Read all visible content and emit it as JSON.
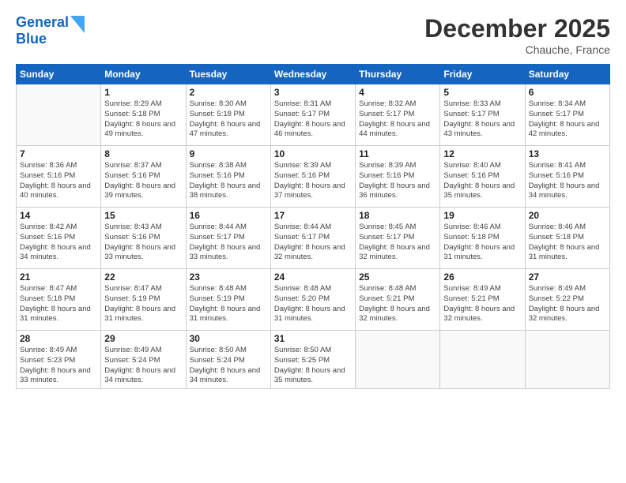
{
  "logo": {
    "line1": "General",
    "line2": "Blue"
  },
  "title": "December 2025",
  "location": "Chauche, France",
  "weekdays": [
    "Sunday",
    "Monday",
    "Tuesday",
    "Wednesday",
    "Thursday",
    "Friday",
    "Saturday"
  ],
  "weeks": [
    [
      {
        "day": "",
        "sunrise": "",
        "sunset": "",
        "daylight": ""
      },
      {
        "day": "1",
        "sunrise": "Sunrise: 8:29 AM",
        "sunset": "Sunset: 5:18 PM",
        "daylight": "Daylight: 8 hours and 49 minutes."
      },
      {
        "day": "2",
        "sunrise": "Sunrise: 8:30 AM",
        "sunset": "Sunset: 5:18 PM",
        "daylight": "Daylight: 8 hours and 47 minutes."
      },
      {
        "day": "3",
        "sunrise": "Sunrise: 8:31 AM",
        "sunset": "Sunset: 5:17 PM",
        "daylight": "Daylight: 8 hours and 46 minutes."
      },
      {
        "day": "4",
        "sunrise": "Sunrise: 8:32 AM",
        "sunset": "Sunset: 5:17 PM",
        "daylight": "Daylight: 8 hours and 44 minutes."
      },
      {
        "day": "5",
        "sunrise": "Sunrise: 8:33 AM",
        "sunset": "Sunset: 5:17 PM",
        "daylight": "Daylight: 8 hours and 43 minutes."
      },
      {
        "day": "6",
        "sunrise": "Sunrise: 8:34 AM",
        "sunset": "Sunset: 5:17 PM",
        "daylight": "Daylight: 8 hours and 42 minutes."
      }
    ],
    [
      {
        "day": "7",
        "sunrise": "Sunrise: 8:36 AM",
        "sunset": "Sunset: 5:16 PM",
        "daylight": "Daylight: 8 hours and 40 minutes."
      },
      {
        "day": "8",
        "sunrise": "Sunrise: 8:37 AM",
        "sunset": "Sunset: 5:16 PM",
        "daylight": "Daylight: 8 hours and 39 minutes."
      },
      {
        "day": "9",
        "sunrise": "Sunrise: 8:38 AM",
        "sunset": "Sunset: 5:16 PM",
        "daylight": "Daylight: 8 hours and 38 minutes."
      },
      {
        "day": "10",
        "sunrise": "Sunrise: 8:39 AM",
        "sunset": "Sunset: 5:16 PM",
        "daylight": "Daylight: 8 hours and 37 minutes."
      },
      {
        "day": "11",
        "sunrise": "Sunrise: 8:39 AM",
        "sunset": "Sunset: 5:16 PM",
        "daylight": "Daylight: 8 hours and 36 minutes."
      },
      {
        "day": "12",
        "sunrise": "Sunrise: 8:40 AM",
        "sunset": "Sunset: 5:16 PM",
        "daylight": "Daylight: 8 hours and 35 minutes."
      },
      {
        "day": "13",
        "sunrise": "Sunrise: 8:41 AM",
        "sunset": "Sunset: 5:16 PM",
        "daylight": "Daylight: 8 hours and 34 minutes."
      }
    ],
    [
      {
        "day": "14",
        "sunrise": "Sunrise: 8:42 AM",
        "sunset": "Sunset: 5:16 PM",
        "daylight": "Daylight: 8 hours and 34 minutes."
      },
      {
        "day": "15",
        "sunrise": "Sunrise: 8:43 AM",
        "sunset": "Sunset: 5:16 PM",
        "daylight": "Daylight: 8 hours and 33 minutes."
      },
      {
        "day": "16",
        "sunrise": "Sunrise: 8:44 AM",
        "sunset": "Sunset: 5:17 PM",
        "daylight": "Daylight: 8 hours and 33 minutes."
      },
      {
        "day": "17",
        "sunrise": "Sunrise: 8:44 AM",
        "sunset": "Sunset: 5:17 PM",
        "daylight": "Daylight: 8 hours and 32 minutes."
      },
      {
        "day": "18",
        "sunrise": "Sunrise: 8:45 AM",
        "sunset": "Sunset: 5:17 PM",
        "daylight": "Daylight: 8 hours and 32 minutes."
      },
      {
        "day": "19",
        "sunrise": "Sunrise: 8:46 AM",
        "sunset": "Sunset: 5:18 PM",
        "daylight": "Daylight: 8 hours and 31 minutes."
      },
      {
        "day": "20",
        "sunrise": "Sunrise: 8:46 AM",
        "sunset": "Sunset: 5:18 PM",
        "daylight": "Daylight: 8 hours and 31 minutes."
      }
    ],
    [
      {
        "day": "21",
        "sunrise": "Sunrise: 8:47 AM",
        "sunset": "Sunset: 5:18 PM",
        "daylight": "Daylight: 8 hours and 31 minutes."
      },
      {
        "day": "22",
        "sunrise": "Sunrise: 8:47 AM",
        "sunset": "Sunset: 5:19 PM",
        "daylight": "Daylight: 8 hours and 31 minutes."
      },
      {
        "day": "23",
        "sunrise": "Sunrise: 8:48 AM",
        "sunset": "Sunset: 5:19 PM",
        "daylight": "Daylight: 8 hours and 31 minutes."
      },
      {
        "day": "24",
        "sunrise": "Sunrise: 8:48 AM",
        "sunset": "Sunset: 5:20 PM",
        "daylight": "Daylight: 8 hours and 31 minutes."
      },
      {
        "day": "25",
        "sunrise": "Sunrise: 8:48 AM",
        "sunset": "Sunset: 5:21 PM",
        "daylight": "Daylight: 8 hours and 32 minutes."
      },
      {
        "day": "26",
        "sunrise": "Sunrise: 8:49 AM",
        "sunset": "Sunset: 5:21 PM",
        "daylight": "Daylight: 8 hours and 32 minutes."
      },
      {
        "day": "27",
        "sunrise": "Sunrise: 8:49 AM",
        "sunset": "Sunset: 5:22 PM",
        "daylight": "Daylight: 8 hours and 32 minutes."
      }
    ],
    [
      {
        "day": "28",
        "sunrise": "Sunrise: 8:49 AM",
        "sunset": "Sunset: 5:23 PM",
        "daylight": "Daylight: 8 hours and 33 minutes."
      },
      {
        "day": "29",
        "sunrise": "Sunrise: 8:49 AM",
        "sunset": "Sunset: 5:24 PM",
        "daylight": "Daylight: 8 hours and 34 minutes."
      },
      {
        "day": "30",
        "sunrise": "Sunrise: 8:50 AM",
        "sunset": "Sunset: 5:24 PM",
        "daylight": "Daylight: 8 hours and 34 minutes."
      },
      {
        "day": "31",
        "sunrise": "Sunrise: 8:50 AM",
        "sunset": "Sunset: 5:25 PM",
        "daylight": "Daylight: 8 hours and 35 minutes."
      },
      {
        "day": "",
        "sunrise": "",
        "sunset": "",
        "daylight": ""
      },
      {
        "day": "",
        "sunrise": "",
        "sunset": "",
        "daylight": ""
      },
      {
        "day": "",
        "sunrise": "",
        "sunset": "",
        "daylight": ""
      }
    ]
  ]
}
